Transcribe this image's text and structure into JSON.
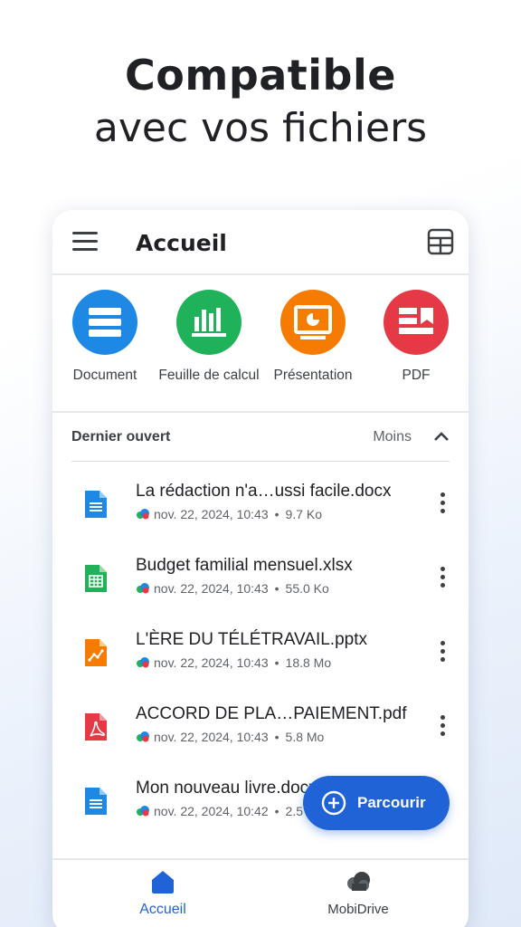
{
  "hero": {
    "title": "Compatible",
    "subtitle": "avec vos fichiers"
  },
  "appbar": {
    "title": "Accueil"
  },
  "categories": [
    {
      "label": "Document",
      "color": "#1e88e5",
      "icon": "document-icon"
    },
    {
      "label": "Feuille de calcul",
      "color": "#1fb25a",
      "icon": "spreadsheet-icon"
    },
    {
      "label": "Présentation",
      "color": "#f57c00",
      "icon": "presentation-icon"
    },
    {
      "label": "PDF",
      "color": "#e53945",
      "icon": "pdf-icon"
    }
  ],
  "recent": {
    "title": "Dernier ouvert",
    "toggle_label": "Moins"
  },
  "files": [
    {
      "name": "La rédaction n'a…ussi facile.docx",
      "date": "nov. 22, 2024, 10:43",
      "size": "9.7 Ko",
      "type": "docx",
      "color": "#1e88e5"
    },
    {
      "name": "Budget familial mensuel.xlsx",
      "date": "nov. 22, 2024, 10:43",
      "size": "55.0 Ko",
      "type": "xlsx",
      "color": "#1fb25a"
    },
    {
      "name": "L'ÈRE DU TÉLÉTRAVAIL.pptx",
      "date": "nov. 22, 2024, 10:43",
      "size": "18.8 Mo",
      "type": "pptx",
      "color": "#f57c00"
    },
    {
      "name": "ACCORD DE PLA…PAIEMENT.pdf",
      "date": "nov. 22, 2024, 10:43",
      "size": "5.8 Mo",
      "type": "pdf",
      "color": "#e53945"
    },
    {
      "name": "Mon nouveau livre.docx",
      "date": "nov. 22, 2024, 10:42",
      "size": "2.5 Ko",
      "type": "docx",
      "color": "#1e88e5"
    }
  ],
  "fab": {
    "label": "Parcourir"
  },
  "bottom_nav": [
    {
      "label": "Accueil",
      "icon": "home-icon",
      "active": true,
      "color": "#1f63d6"
    },
    {
      "label": "MobiDrive",
      "icon": "cloud-icon",
      "active": false,
      "color": "#3c4043"
    }
  ]
}
